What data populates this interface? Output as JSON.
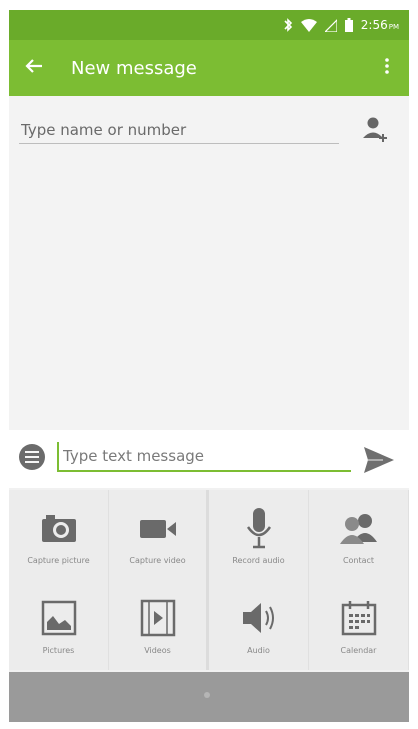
{
  "status_bar": {
    "time": "2:56",
    "time_suffix": "PM",
    "icons": [
      "bluetooth-icon",
      "wifi-icon",
      "signal-icon",
      "battery-icon"
    ]
  },
  "app_bar": {
    "title": "New message",
    "back_icon": "arrow-back-icon",
    "menu_icon": "overflow-menu-icon"
  },
  "recipient": {
    "placeholder": "Type name or number",
    "value": ""
  },
  "compose": {
    "placeholder": "Type text message",
    "value": ""
  },
  "attachments": [
    {
      "label": "Capture picture",
      "icon": "camera-icon"
    },
    {
      "label": "Capture video",
      "icon": "video-camera-icon"
    },
    {
      "label": "Record audio",
      "icon": "microphone-icon"
    },
    {
      "label": "Contact",
      "icon": "contacts-icon"
    },
    {
      "label": "Pictures",
      "icon": "picture-icon"
    },
    {
      "label": "Videos",
      "icon": "video-file-icon"
    },
    {
      "label": "Audio",
      "icon": "speaker-icon"
    },
    {
      "label": "Calendar",
      "icon": "calendar-icon"
    }
  ],
  "colors": {
    "status_bar": "#6aab2a",
    "app_bar": "#7cbd33",
    "accent": "#7cbd33",
    "nav_bar": "#9a9a9a"
  }
}
